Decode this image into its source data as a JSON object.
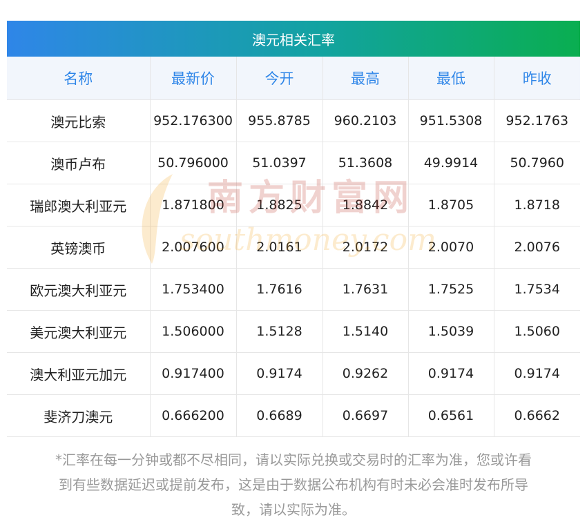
{
  "title": "澳元相关汇率",
  "headers": [
    "名称",
    "最新价",
    "今开",
    "最高",
    "最低",
    "昨收"
  ],
  "rows": [
    [
      "澳元比索",
      "952.176300",
      "955.8785",
      "960.2103",
      "951.5308",
      "952.1763"
    ],
    [
      "澳币卢布",
      "50.796000",
      "51.0397",
      "51.3608",
      "49.9914",
      "50.7960"
    ],
    [
      "瑞郎澳大利亚元",
      "1.871800",
      "1.8825",
      "1.8842",
      "1.8705",
      "1.8718"
    ],
    [
      "英镑澳币",
      "2.007600",
      "2.0161",
      "2.0172",
      "2.0070",
      "2.0076"
    ],
    [
      "欧元澳大利亚元",
      "1.753400",
      "1.7616",
      "1.7631",
      "1.7525",
      "1.7534"
    ],
    [
      "美元澳大利亚元",
      "1.506000",
      "1.5128",
      "1.5140",
      "1.5039",
      "1.5060"
    ],
    [
      "澳大利亚元加元",
      "0.917400",
      "0.9174",
      "0.9262",
      "0.9174",
      "0.9174"
    ],
    [
      "斐济刀澳元",
      "0.666200",
      "0.6689",
      "0.6697",
      "0.6561",
      "0.6662"
    ]
  ],
  "watermark": {
    "cn": "南方财富网",
    "en": "southmoney.com"
  },
  "note": {
    "line1": "*汇率在每一分钟或都不尽相同，请以实际兑换或交易时的汇率为准，您或许看",
    "line2": "到有些数据延迟或提前发布，这是由于数据公布机构有时未必会准时发布所导",
    "line3": "致，请以实际为准。"
  },
  "colors": {
    "header_gradient_start": "#2f86e8",
    "header_gradient_end": "#0aae50",
    "column_header_text": "#2f86e8",
    "column_header_bg": "#f2f6fc",
    "note_text": "#999999"
  }
}
